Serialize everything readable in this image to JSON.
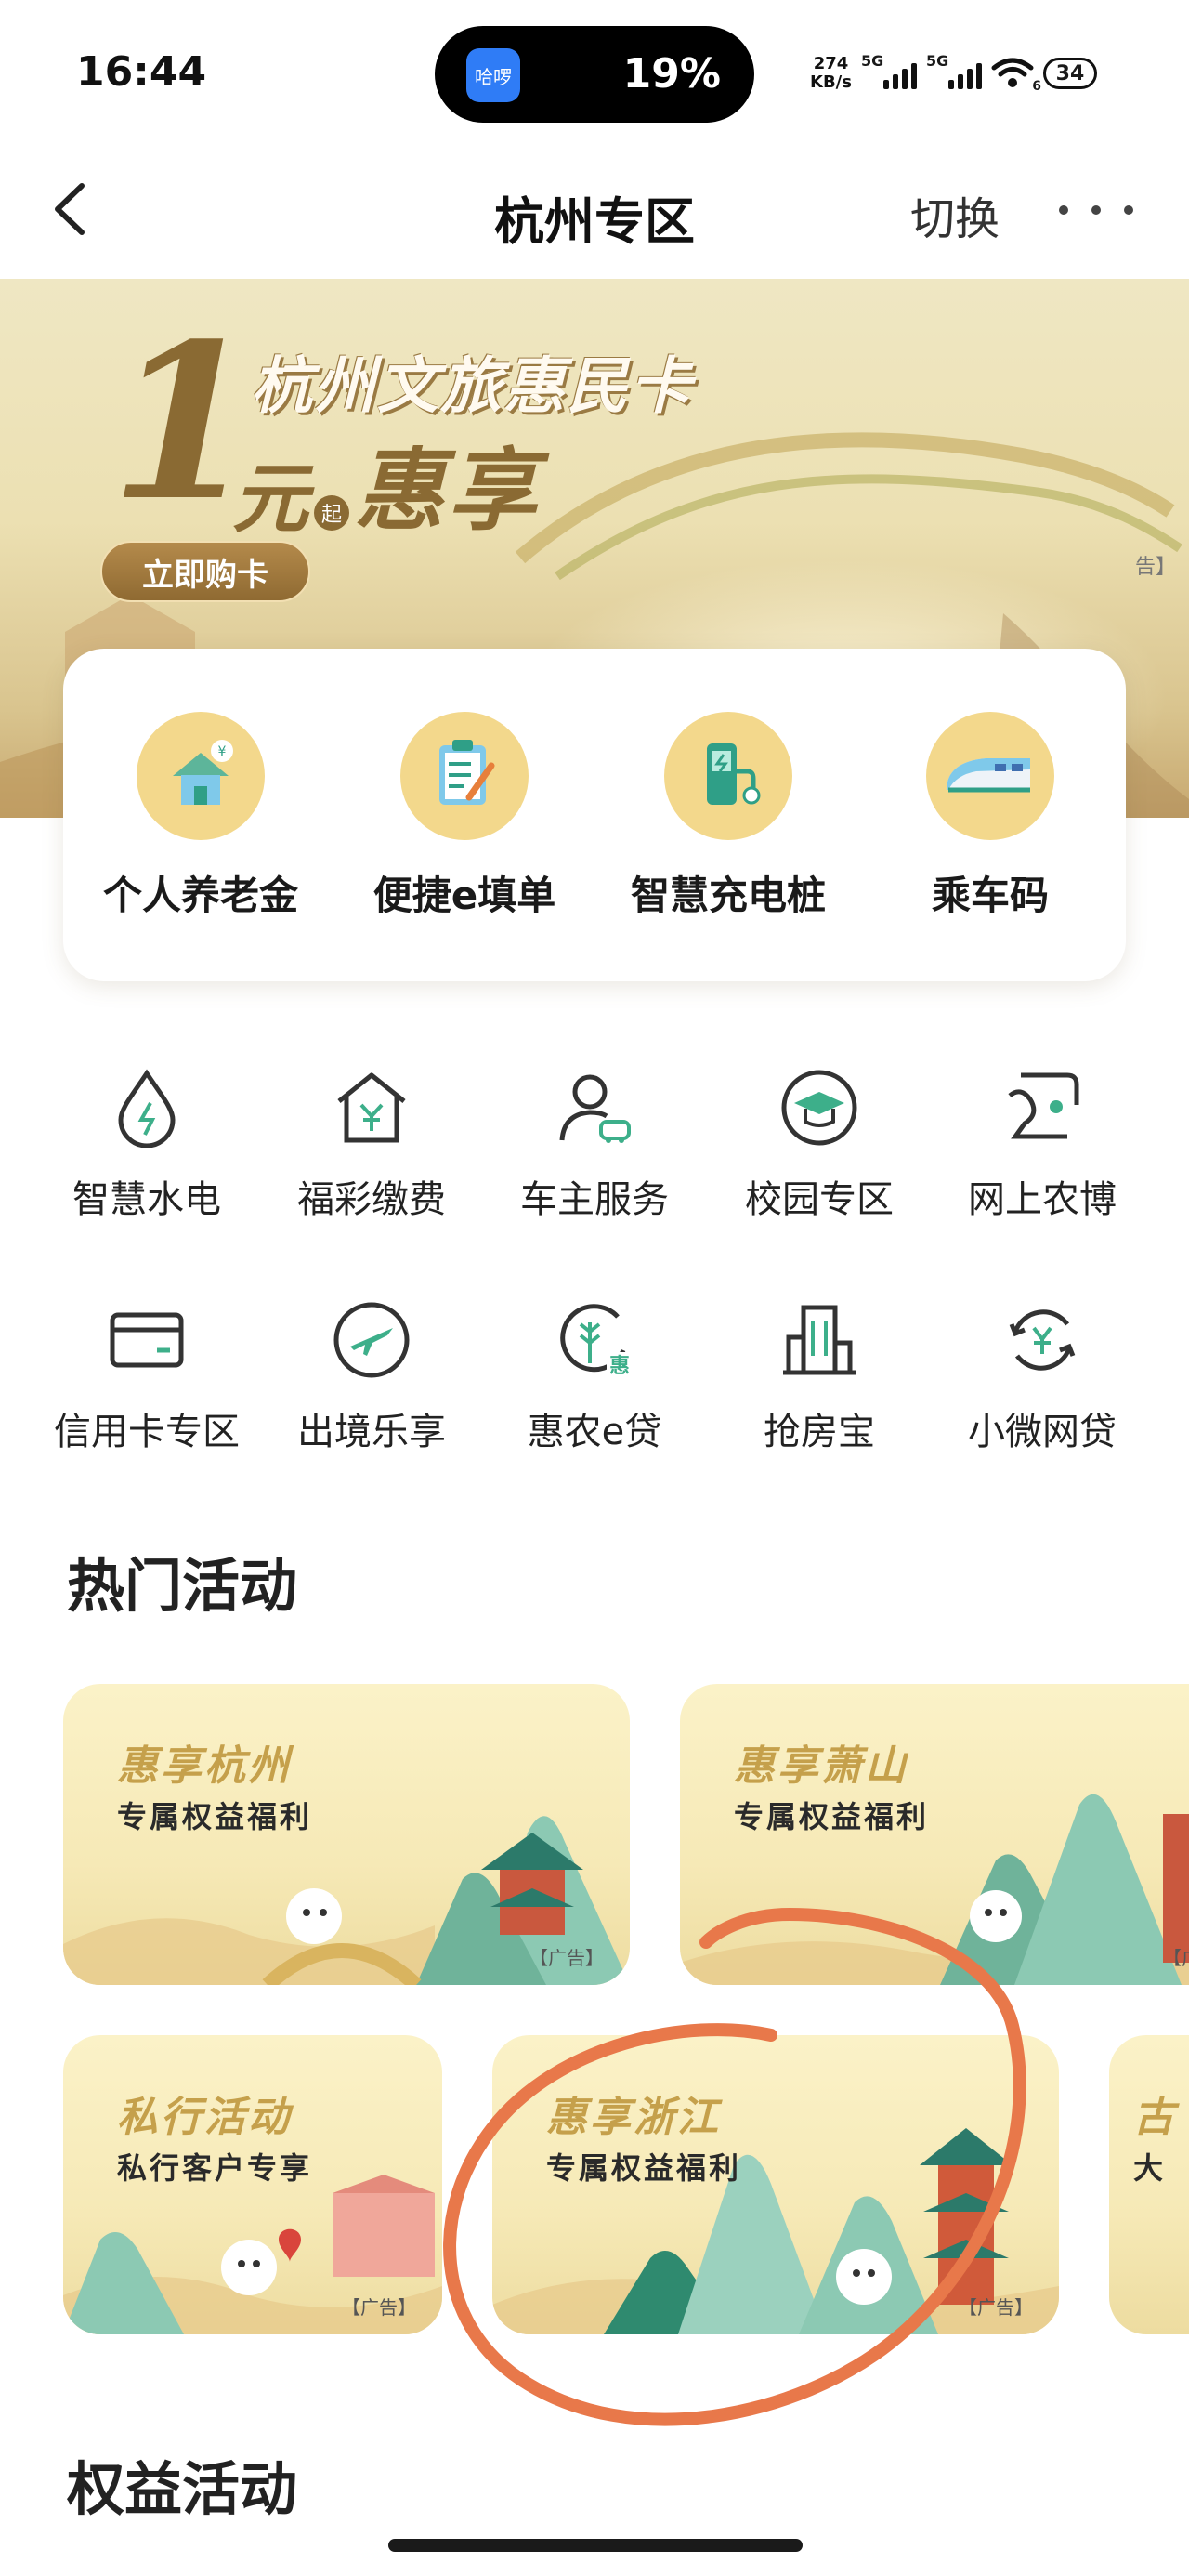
{
  "status_bar": {
    "time": "16:44",
    "island_app": "哈啰",
    "battery_percent": "19%",
    "net_speed_value": "274",
    "net_speed_unit": "KB/s",
    "signal1_label": "5G",
    "signal2_label": "5G",
    "wifi_label": "6",
    "battery_level": "34"
  },
  "nav": {
    "title": "杭州专区",
    "switch_label": "切换"
  },
  "banner": {
    "big_number": "1",
    "line1": "杭州文旅惠民卡",
    "yuan": "元",
    "qi": "起",
    "main": "惠享",
    "button": "立即购卡",
    "ad_tag": "告】"
  },
  "quick_items": [
    {
      "label": "个人养老金",
      "icon": "pension-house-icon"
    },
    {
      "label": "便捷e填单",
      "icon": "clipboard-form-icon"
    },
    {
      "label": "智慧充电桩",
      "icon": "charging-pile-icon"
    },
    {
      "label": "乘车码",
      "icon": "train-icon"
    }
  ],
  "services": [
    {
      "label": "智慧水电",
      "icon": "water-drop-icon"
    },
    {
      "label": "福彩缴费",
      "icon": "yuan-house-icon"
    },
    {
      "label": "车主服务",
      "icon": "car-owner-icon"
    },
    {
      "label": "校园专区",
      "icon": "graduation-cap-icon"
    },
    {
      "label": "网上农博",
      "icon": "farm-expo-icon"
    },
    {
      "label": "信用卡专区",
      "icon": "credit-card-icon"
    },
    {
      "label": "出境乐享",
      "icon": "airplane-icon"
    },
    {
      "label": "惠农e贷",
      "icon": "wheat-loan-icon"
    },
    {
      "label": "抢房宝",
      "icon": "building-icon"
    },
    {
      "label": "小微网贷",
      "icon": "yuan-cycle-icon"
    }
  ],
  "sections": {
    "hot": "热门活动",
    "rights": "权益活动"
  },
  "activities": [
    {
      "title": "惠享杭州",
      "sub": "专属权益福利",
      "ad": "【广告】"
    },
    {
      "title": "惠享萧山",
      "sub": "专属权益福利",
      "ad": "【广"
    },
    {
      "title": "私行活动",
      "sub": "私行客户专享",
      "ad": "【广告】"
    },
    {
      "title": "惠享浙江",
      "sub": "专属权益福利",
      "ad": "【广告】"
    },
    {
      "title": "古",
      "sub": "大",
      "ad": ""
    }
  ],
  "colors": {
    "accent_green": "#3daf8a",
    "icon_gold": "#f3d88c",
    "annotation_orange": "#e8784a"
  }
}
